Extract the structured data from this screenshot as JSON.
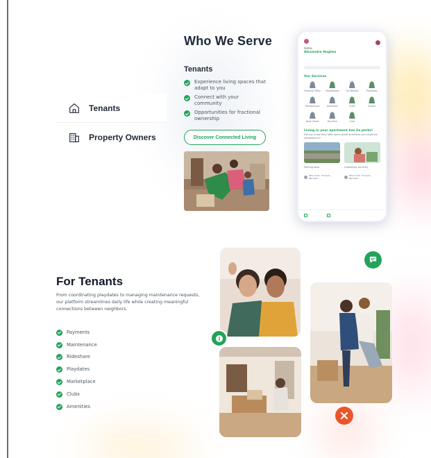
{
  "tabs": [
    {
      "label": "Tenants",
      "icon": "house-icon",
      "active": true
    },
    {
      "label": "Property Owners",
      "icon": "building-icon",
      "active": false
    }
  ],
  "who_we_serve": {
    "title": "Who We Serve",
    "subtitle": "Tenants",
    "benefits": [
      "Experience living spaces that adapt to you",
      "Connect with your community",
      "Opportunities for fractional ownership"
    ],
    "cta_label": "Discover Connected Living"
  },
  "phone": {
    "greeting": "Hello,",
    "user_name": "Alexandra Hughes",
    "services_title": "Our Services",
    "services": [
      "Property Office",
      "Marketplace",
      "Car Rentals",
      "Playdates",
      "Maintenance",
      "Amenities",
      "Clubs",
      "Events",
      "Book Sheet",
      "Pay Rent",
      "Chat"
    ],
    "living_title": "Living in your apartment has its perks!",
    "living_sub": "Did you know they offer some great amenities you might be interested in?",
    "cards": [
      "Parking pass",
      "Coworking services"
    ],
    "people": [
      "Mike Scott · Property Manager",
      "Mike Scott · Property Manager"
    ]
  },
  "for_tenants": {
    "title": "For Tenants",
    "description": "From coordinating playdates to managing maintenance requests, our platform streamlines daily life while creating meaningful connections between neighbors.",
    "features": [
      "Payments",
      "Maintenance",
      "Rideshare",
      "Playdates",
      "Marketplace",
      "Clubs",
      "Amenities"
    ]
  },
  "colors": {
    "accent_green": "#22a35a",
    "accent_orange": "#e8572b",
    "text_dark": "#1f2937"
  }
}
